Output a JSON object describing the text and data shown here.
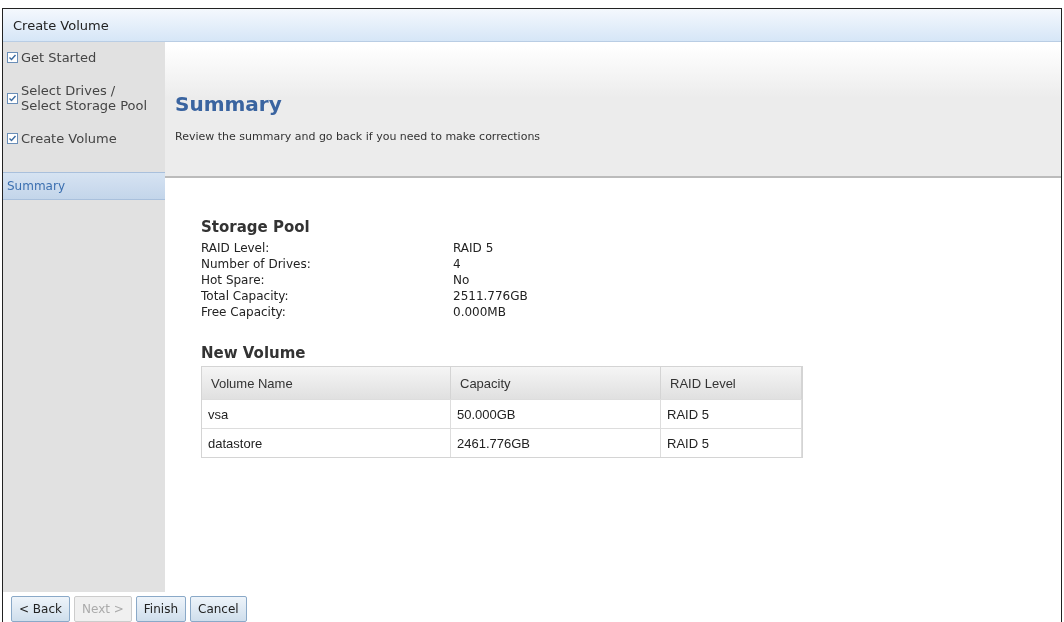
{
  "window": {
    "title": "Create Volume"
  },
  "steps": [
    {
      "label": "Get Started",
      "checked": true,
      "selected": false
    },
    {
      "label": "Select Drives / Select Storage Pool",
      "checked": true,
      "selected": false
    },
    {
      "label": "Create Volume",
      "checked": true,
      "selected": false
    },
    {
      "label": "Summary",
      "checked": false,
      "selected": true
    }
  ],
  "header": {
    "title": "Summary",
    "subtitle": "Review the summary and go back if you need to make corrections"
  },
  "storage_pool": {
    "title": "Storage Pool",
    "rows": [
      {
        "label": "RAID Level:",
        "value": "RAID 5"
      },
      {
        "label": "Number of Drives:",
        "value": "4"
      },
      {
        "label": "Hot Spare:",
        "value": "No"
      },
      {
        "label": "Total Capacity:",
        "value": "2511.776GB"
      },
      {
        "label": "Free Capacity:",
        "value": "0.000MB"
      }
    ]
  },
  "new_volume": {
    "title": "New Volume",
    "columns": [
      "Volume Name",
      "Capacity",
      "RAID Level"
    ],
    "rows": [
      [
        "vsa",
        "50.000GB",
        "RAID 5"
      ],
      [
        "datastore",
        "2461.776GB",
        "RAID 5"
      ]
    ]
  },
  "buttons": [
    {
      "label": "< Back",
      "disabled": false
    },
    {
      "label": "Next >",
      "disabled": true
    },
    {
      "label": "Finish",
      "disabled": false
    },
    {
      "label": "Cancel",
      "disabled": false
    }
  ]
}
